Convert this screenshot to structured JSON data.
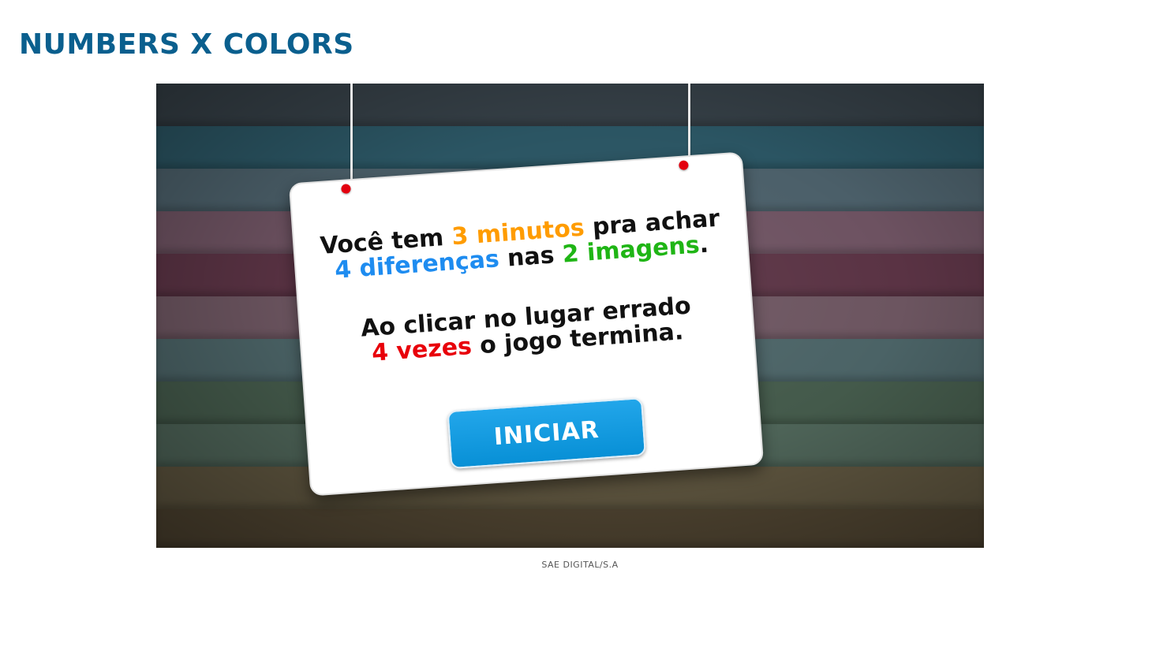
{
  "page": {
    "title": "NUMBERS X COLORS",
    "credit": "SAE DIGITAL/S.A"
  },
  "game": {
    "line1": {
      "part1": "Você tem ",
      "highlight1": "3 minutos",
      "part2": " pra achar"
    },
    "line2": {
      "highlight1": "4 diferenças",
      "part1": " nas ",
      "highlight2": "2 imagens",
      "part2": "."
    },
    "line3": "Ao clicar no lugar errado",
    "line4": {
      "highlight1": "4 vezes",
      "part1": " o jogo termina."
    },
    "start_button": "INICIAR"
  },
  "colors": {
    "title": "#0a5f8e",
    "time_highlight": "#ff9c00",
    "differences_highlight": "#1e8cf0",
    "images_highlight": "#1fb515",
    "mistakes_highlight": "#e8000a",
    "button": "#14a0e6",
    "pins": "#e3000f"
  }
}
